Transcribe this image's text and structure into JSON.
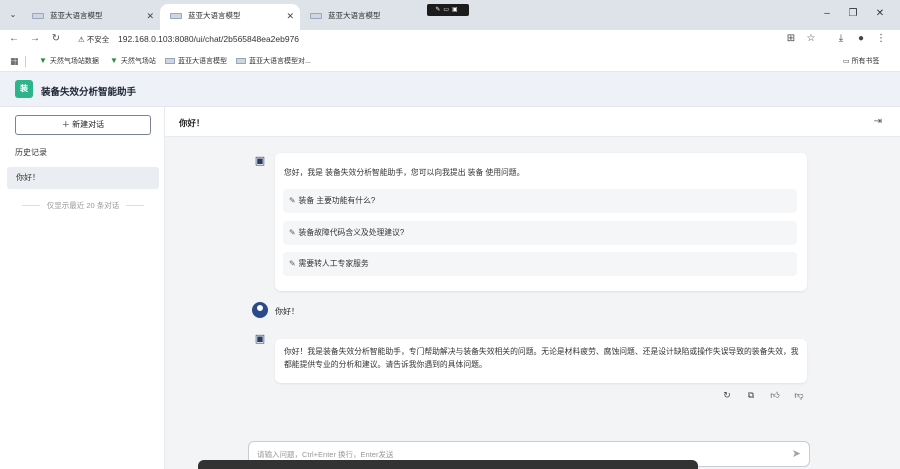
{
  "browser": {
    "tabs": [
      {
        "title": "蓝亚大语言模型",
        "active": false
      },
      {
        "title": "蓝亚大语言模型",
        "active": true
      },
      {
        "title": "蓝亚大语言模型",
        "active": false
      }
    ],
    "security_label": "不安全",
    "url": "192.168.0.103:8080/ui/chat/2b565848ea2eb976",
    "bookmarks": [
      "天然气场站数据",
      "天然气场站",
      "蓝亚大语言模型",
      "蓝亚大语言模型对..."
    ],
    "all_bookmarks": "所有书签"
  },
  "app": {
    "logo_text": "装",
    "title": "装备失效分析智能助手"
  },
  "sidebar": {
    "new_chat": "＋ 新建对话",
    "history_title": "历史记录",
    "history_items": [
      "你好！"
    ],
    "note": "仅显示最近 20 条对话"
  },
  "chat": {
    "title": "你好！",
    "greeting": "您好，我是 装备失效分析智能助手，您可以向我提出 装备 使用问题。",
    "suggestions": [
      "装备 主要功能有什么?",
      "装备故障代码含义及处理建议?",
      "需要转人工专家服务"
    ],
    "user_message": "你好！",
    "answer": "你好！我是装备失效分析智能助手，专门帮助解决与装备失效相关的问题。无论是材料疲劳、腐蚀问题、还是设计缺陷或操作失误导致的装备失效，我都能提供专业的分析和建议。请告诉我你遇到的具体问题。",
    "input_placeholder": "请输入问题，Ctrl+Enter 换行，Enter发送"
  }
}
